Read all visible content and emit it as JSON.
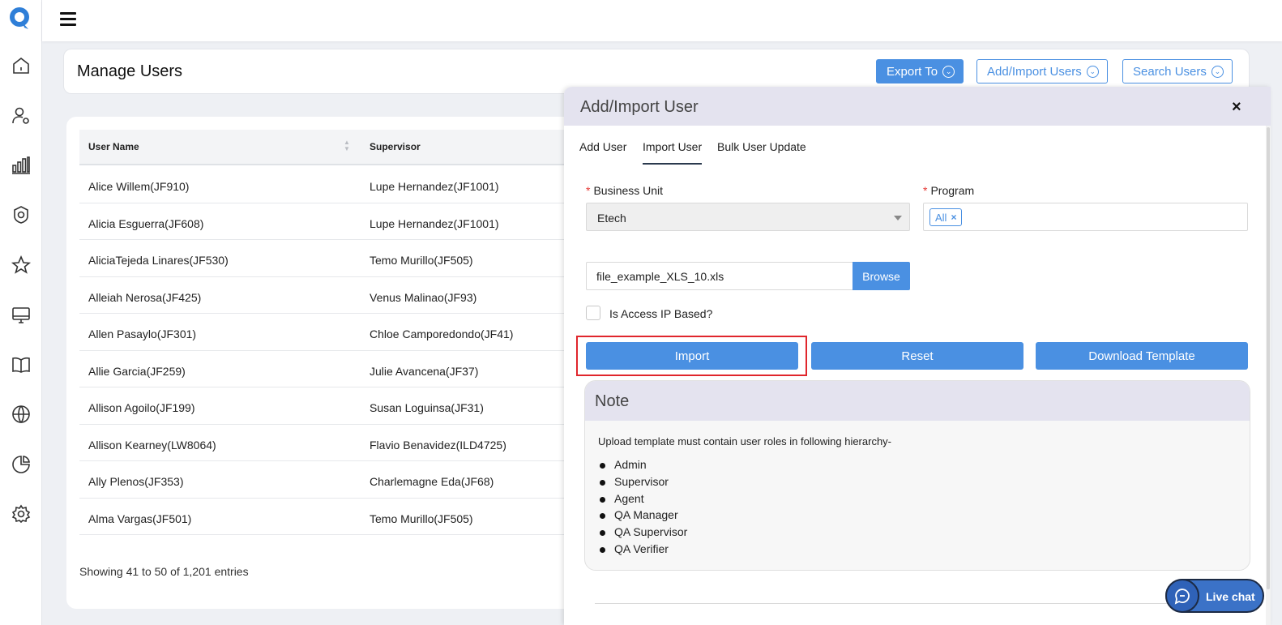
{
  "sidebar": {
    "icons": [
      "home-icon",
      "user-gear-icon",
      "bar-chart-icon",
      "badge-icon",
      "star-icon",
      "monitor-icon",
      "book-icon",
      "globe-icon",
      "pie-chart-icon",
      "settings-icon"
    ]
  },
  "header": {
    "title": "Manage Users",
    "export_label": "Export To",
    "add_import_label": "Add/Import Users",
    "search_label": "Search Users"
  },
  "table": {
    "columns": [
      "User Name",
      "Supervisor"
    ],
    "rows": [
      {
        "user": "Alice Willem(JF910)",
        "supervisor": "Lupe Hernandez(JF1001)"
      },
      {
        "user": "Alicia Esguerra(JF608)",
        "supervisor": "Lupe Hernandez(JF1001)"
      },
      {
        "user": "AliciaTejeda Linares(JF530)",
        "supervisor": "Temo Murillo(JF505)"
      },
      {
        "user": "Alleiah Nerosa(JF425)",
        "supervisor": "Venus Malinao(JF93)"
      },
      {
        "user": "Allen Pasaylo(JF301)",
        "supervisor": "Chloe Camporedondo(JF41)"
      },
      {
        "user": "Allie Garcia(JF259)",
        "supervisor": "Julie Avancena(JF37)"
      },
      {
        "user": "Allison Agoilo(JF199)",
        "supervisor": "Susan Loguinsa(JF31)"
      },
      {
        "user": "Allison Kearney(LW8064)",
        "supervisor": "Flavio Benavidez(ILD4725)"
      },
      {
        "user": "Ally Plenos(JF353)",
        "supervisor": "Charlemagne Eda(JF68)"
      },
      {
        "user": "Alma Vargas(JF501)",
        "supervisor": "Temo Murillo(JF505)"
      }
    ],
    "footer": "Showing 41 to 50 of 1,201 entries"
  },
  "modal": {
    "title": "Add/Import User",
    "close": "×",
    "tabs": [
      "Add User",
      "Import User",
      "Bulk User Update"
    ],
    "active_tab": "Import User",
    "business_unit_label": "Business Unit",
    "business_unit_value": "Etech",
    "program_label": "Program",
    "program_tag": "All",
    "program_tag_remove": "×",
    "required_mark": "*",
    "file_name": "file_example_XLS_10.xls",
    "browse_label": "Browse",
    "ip_based_label": "Is Access IP Based?",
    "import_label": "Import",
    "reset_label": "Reset",
    "download_label": "Download Template",
    "note": {
      "title": "Note",
      "text": "Upload template must contain user roles in following hierarchy-",
      "roles": [
        "Admin",
        "Supervisor",
        "Agent",
        "QA Manager",
        "QA Supervisor",
        "QA Verifier"
      ]
    }
  },
  "livechat": {
    "label": "Live chat"
  },
  "colors": {
    "accent": "#4a90e2",
    "highlight": "#e0262c",
    "modal_header": "#e4e3ef"
  }
}
